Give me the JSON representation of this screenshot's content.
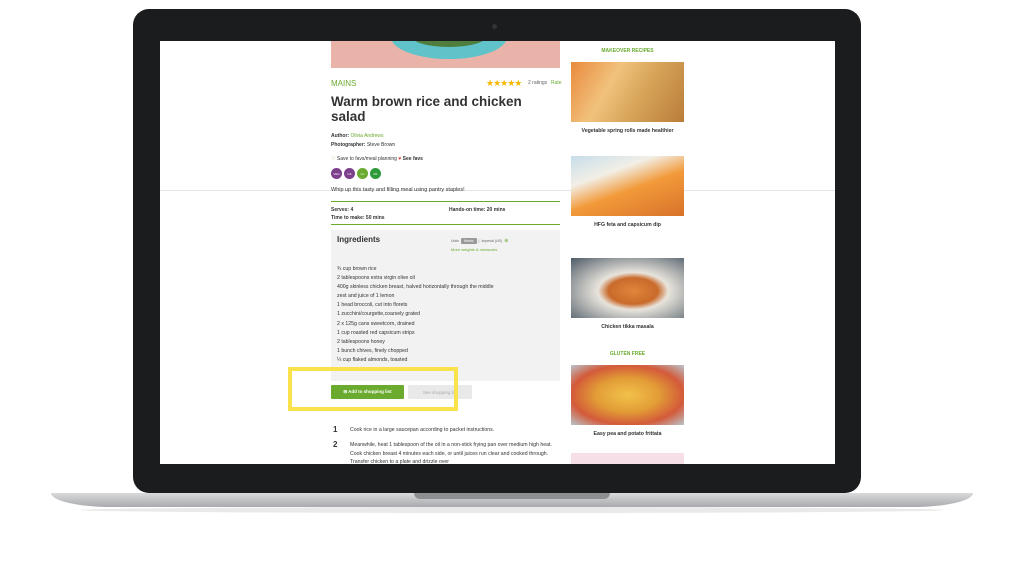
{
  "recipe": {
    "category": "MAINS",
    "stars": "★★★★★",
    "ratings": "2 ratings",
    "rate_link": "Rate",
    "title": "Warm brown rice and chicken salad",
    "author_label": "Author:",
    "author": "Olivia Andrews",
    "photographer_label": "Photographer:",
    "photographer": "Steve Brown",
    "save_label": "Save to favs/meal planning",
    "see_favs": "See favs",
    "intro": "Whip up this tasty and filling meal using pantry staples!",
    "serves": "Serves: 4",
    "hands_on": "Hands-on time: 20 mins",
    "time_to_make": "Time to make: 50 mins",
    "badges": [
      {
        "text": "VEG",
        "color": "#7b3f8c"
      },
      {
        "text": "GF",
        "color": "#7b3f8c"
      },
      {
        "text": "LC",
        "color": "#6aab2f"
      },
      {
        "text": "DF",
        "color": "#2e9a3a"
      }
    ]
  },
  "ingredients": {
    "heading": "Ingredients",
    "units_label": "Units",
    "metric": "Metric",
    "separator": "|",
    "imperial": "Imperial (US)",
    "plus": "⊕",
    "more_weights": "More weights & measures",
    "items": [
      "¾ cup brown rice",
      "2 tablespoons extra virgin olive oil",
      "400g skinless chicken breast, halved horizontally through the middle",
      "zest and juice of 1 lemon",
      "1 head broccoli, cut into florets",
      "1 zucchini/courgette,coarsely grated",
      "2 x 125g cans sweetcorn, drained",
      "1 cup roasted red capsicum strips",
      "2 tablespoons honey",
      "1 bunch chives, finely chopped",
      "¼ cup flaked almonds, toasted"
    ]
  },
  "buttons": {
    "add_shopping": "⊞ Add to shopping list",
    "see_shopping": "See shopping list"
  },
  "method": {
    "steps": [
      {
        "num": "1",
        "text": "Cook rice in a large saucepan according to packet instructions."
      },
      {
        "num": "2",
        "text": "Meanwhile, heat 1 tablespoon of the oil in a non-stick frying pan over medium high heat. Cook chicken breast 4 minutes each side, or until juices run clear and cooked through. Transfer chicken to a plate and drizzle over"
      }
    ]
  },
  "sidebar": {
    "makeover_heading": "MAKEOVER RECIPES",
    "gluten_heading": "GLUTEN FREE",
    "cards": [
      {
        "caption": "Vegetable spring rolls made healthier"
      },
      {
        "caption": "HFG feta and capsicum dip"
      },
      {
        "caption": "Chicken tikka masala"
      },
      {
        "caption": "Easy pea and potato frittata"
      }
    ]
  },
  "colors": {
    "accent_green": "#6aab2f",
    "highlight_yellow": "#f9e24b",
    "star_gold": "#f5b800"
  }
}
